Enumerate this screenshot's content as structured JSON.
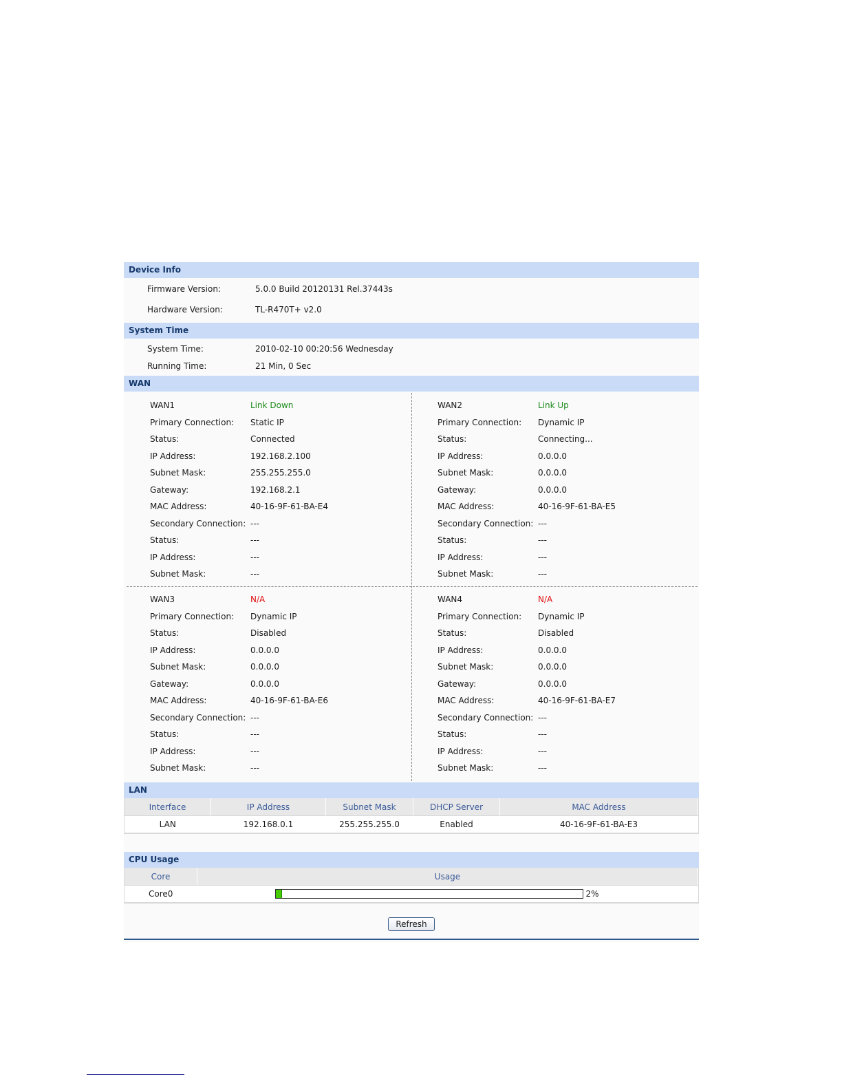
{
  "device_info": {
    "header": "Device Info",
    "rows": [
      {
        "label": "Firmware Version:",
        "value": "5.0.0 Build 20120131 Rel.37443s"
      },
      {
        "label": "Hardware Version:",
        "value": "TL-R470T+ v2.0"
      }
    ]
  },
  "system_time": {
    "header": "System Time",
    "rows": [
      {
        "label": "System Time:",
        "value": "2010-02-10 00:20:56 Wednesday"
      },
      {
        "label": "Running Time:",
        "value": "21 Min, 0 Sec"
      }
    ]
  },
  "wan": {
    "header": "WAN",
    "ports": [
      {
        "name": "WAN1",
        "link": "Link Down",
        "rows": [
          {
            "label": "Primary Connection:",
            "value": "Static IP"
          },
          {
            "label": "Status:",
            "value": "Connected"
          },
          {
            "label": "IP Address:",
            "value": "192.168.2.100"
          },
          {
            "label": "Subnet Mask:",
            "value": "255.255.255.0"
          },
          {
            "label": "Gateway:",
            "value": "192.168.2.1"
          },
          {
            "label": "MAC Address:",
            "value": "40-16-9F-61-BA-E4"
          },
          {
            "label": "Secondary Connection:",
            "value": "---"
          },
          {
            "label": "Status:",
            "value": "---"
          },
          {
            "label": "IP Address:",
            "value": "---"
          },
          {
            "label": "Subnet Mask:",
            "value": "---"
          }
        ]
      },
      {
        "name": "WAN2",
        "link": "Link Up",
        "rows": [
          {
            "label": "Primary Connection:",
            "value": "Dynamic IP"
          },
          {
            "label": "Status:",
            "value": "Connecting..."
          },
          {
            "label": "IP Address:",
            "value": "0.0.0.0"
          },
          {
            "label": "Subnet Mask:",
            "value": "0.0.0.0"
          },
          {
            "label": "Gateway:",
            "value": "0.0.0.0"
          },
          {
            "label": "MAC Address:",
            "value": "40-16-9F-61-BA-E5"
          },
          {
            "label": "Secondary Connection:",
            "value": "---"
          },
          {
            "label": "Status:",
            "value": "---"
          },
          {
            "label": "IP Address:",
            "value": "---"
          },
          {
            "label": "Subnet Mask:",
            "value": "---"
          }
        ]
      },
      {
        "name": "WAN3",
        "link": "N/A",
        "rows": [
          {
            "label": "Primary Connection:",
            "value": "Dynamic IP"
          },
          {
            "label": "Status:",
            "value": "Disabled"
          },
          {
            "label": "IP Address:",
            "value": "0.0.0.0"
          },
          {
            "label": "Subnet Mask:",
            "value": "0.0.0.0"
          },
          {
            "label": "Gateway:",
            "value": "0.0.0.0"
          },
          {
            "label": "MAC Address:",
            "value": "40-16-9F-61-BA-E6"
          },
          {
            "label": "Secondary Connection:",
            "value": "---"
          },
          {
            "label": "Status:",
            "value": "---"
          },
          {
            "label": "IP Address:",
            "value": "---"
          },
          {
            "label": "Subnet Mask:",
            "value": "---"
          }
        ]
      },
      {
        "name": "WAN4",
        "link": "N/A",
        "rows": [
          {
            "label": "Primary Connection:",
            "value": "Dynamic IP"
          },
          {
            "label": "Status:",
            "value": "Disabled"
          },
          {
            "label": "IP Address:",
            "value": "0.0.0.0"
          },
          {
            "label": "Subnet Mask:",
            "value": "0.0.0.0"
          },
          {
            "label": "Gateway:",
            "value": "0.0.0.0"
          },
          {
            "label": "MAC Address:",
            "value": "40-16-9F-61-BA-E7"
          },
          {
            "label": "Secondary Connection:",
            "value": "---"
          },
          {
            "label": "Status:",
            "value": "---"
          },
          {
            "label": "IP Address:",
            "value": "---"
          },
          {
            "label": "Subnet Mask:",
            "value": "---"
          }
        ]
      }
    ]
  },
  "lan": {
    "header": "LAN",
    "columns": [
      "Interface",
      "IP Address",
      "Subnet Mask",
      "DHCP Server",
      "MAC Address"
    ],
    "rows": [
      [
        "LAN",
        "192.168.0.1",
        "255.255.255.0",
        "Enabled",
        "40-16-9F-61-BA-E3"
      ]
    ]
  },
  "cpu": {
    "header": "CPU Usage",
    "columns": [
      "Core",
      "Usage"
    ],
    "rows": [
      {
        "core": "Core0",
        "usage_percent": 2,
        "usage_text": "2%"
      }
    ]
  },
  "refresh_label": "Refresh",
  "colors": {
    "link_up": "#1a8a1a",
    "link_down": "#1a8a1a",
    "not_available": "#e01010",
    "header_bg": "#c9dbf6",
    "usage_bar": "#44cc00"
  }
}
